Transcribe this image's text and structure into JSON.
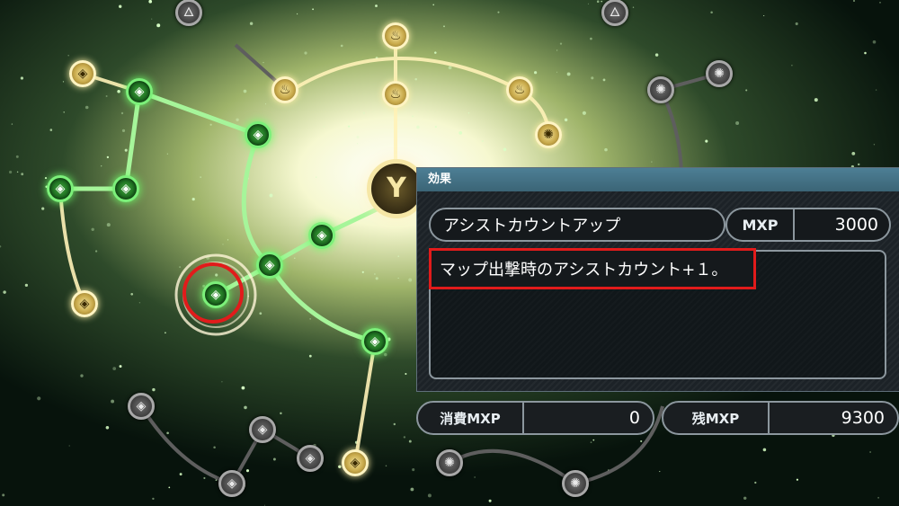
{
  "panel": {
    "header": "効果",
    "skill_name": "アシストカウントアップ",
    "cost_label": "MXP",
    "cost_value": "3000",
    "description": "マップ出撃時のアシストカウント+１。"
  },
  "stats": {
    "used_label": "消費MXP",
    "used_value": "0",
    "remaining_label": "残MXP",
    "remaining_value": "9300"
  },
  "icons": {
    "green_node": "diamond-icon",
    "gold_fire_node": "flame-icon",
    "gold_diamond_node": "diamond-icon",
    "gray_atom_node": "atom-icon",
    "center_node": "y-emblem-icon"
  },
  "colors": {
    "selection_highlight": "#e11b1b",
    "unlocked_green": "#7cf07a",
    "gold": "#f3e39a",
    "locked_gray": "#6e6e6e",
    "panel_header": "#4d7f95"
  }
}
